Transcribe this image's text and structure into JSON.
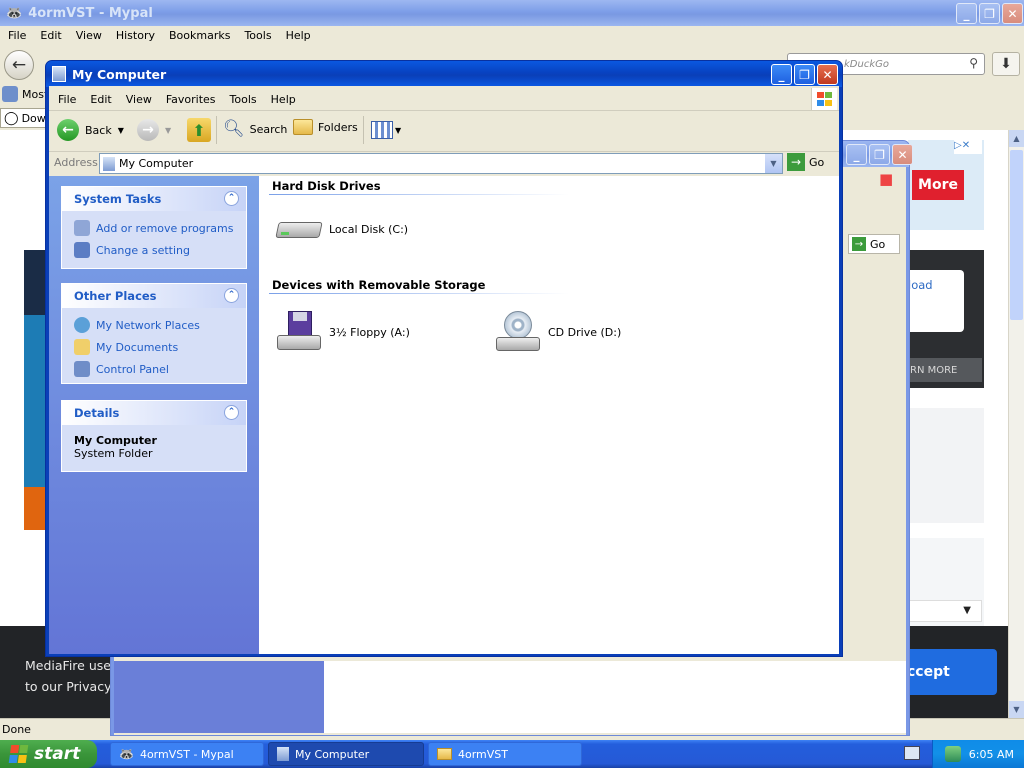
{
  "browser": {
    "title": "4ormVST - Mypal",
    "menu": [
      "File",
      "Edit",
      "View",
      "History",
      "Bookmarks",
      "Tools",
      "Help"
    ],
    "search_placeholder": "kDuckGo",
    "bookmark_most": "Most",
    "bookmark_dow": "Dow",
    "status": "Done",
    "page": {
      "more_button": "More",
      "upload_text": "load",
      "learn_more": "RN MORE",
      "accept_button": "ccept",
      "cookie_text_line1": "MediaFire uses",
      "cookie_text_line2": "to our Privacy I"
    }
  },
  "mid_window": {
    "go_label": "Go"
  },
  "explorer": {
    "title": "My Computer",
    "menu": [
      "File",
      "Edit",
      "View",
      "Favorites",
      "Tools",
      "Help"
    ],
    "toolbar": {
      "back": "Back",
      "search": "Search",
      "folders": "Folders"
    },
    "address_label": "Address",
    "address_value": "My Computer",
    "go_label": "Go",
    "system_tasks": {
      "title": "System Tasks",
      "items": [
        "Add or remove programs",
        "Change a setting"
      ]
    },
    "other_places": {
      "title": "Other Places",
      "items": [
        "My Network Places",
        "My Documents",
        "Control Panel"
      ]
    },
    "details": {
      "title": "Details",
      "name": "My Computer",
      "type": "System Folder"
    },
    "groups": [
      {
        "title": "Hard Disk Drives",
        "items": [
          "Local Disk (C:)"
        ]
      },
      {
        "title": "Devices with Removable Storage",
        "items": [
          "3½ Floppy (A:)",
          "CD Drive (D:)"
        ]
      }
    ]
  },
  "taskbar": {
    "start_label": "start",
    "buttons": [
      "4ormVST - Mypal",
      "My Computer",
      "4ormVST"
    ],
    "clock": "6:05 AM"
  },
  "colors": {
    "xp_blue": "#0A3FB8",
    "link_blue": "#215DC6",
    "more_red": "#E0202E",
    "accept_blue": "#1F6CE0",
    "start_green": "#3A953A"
  }
}
